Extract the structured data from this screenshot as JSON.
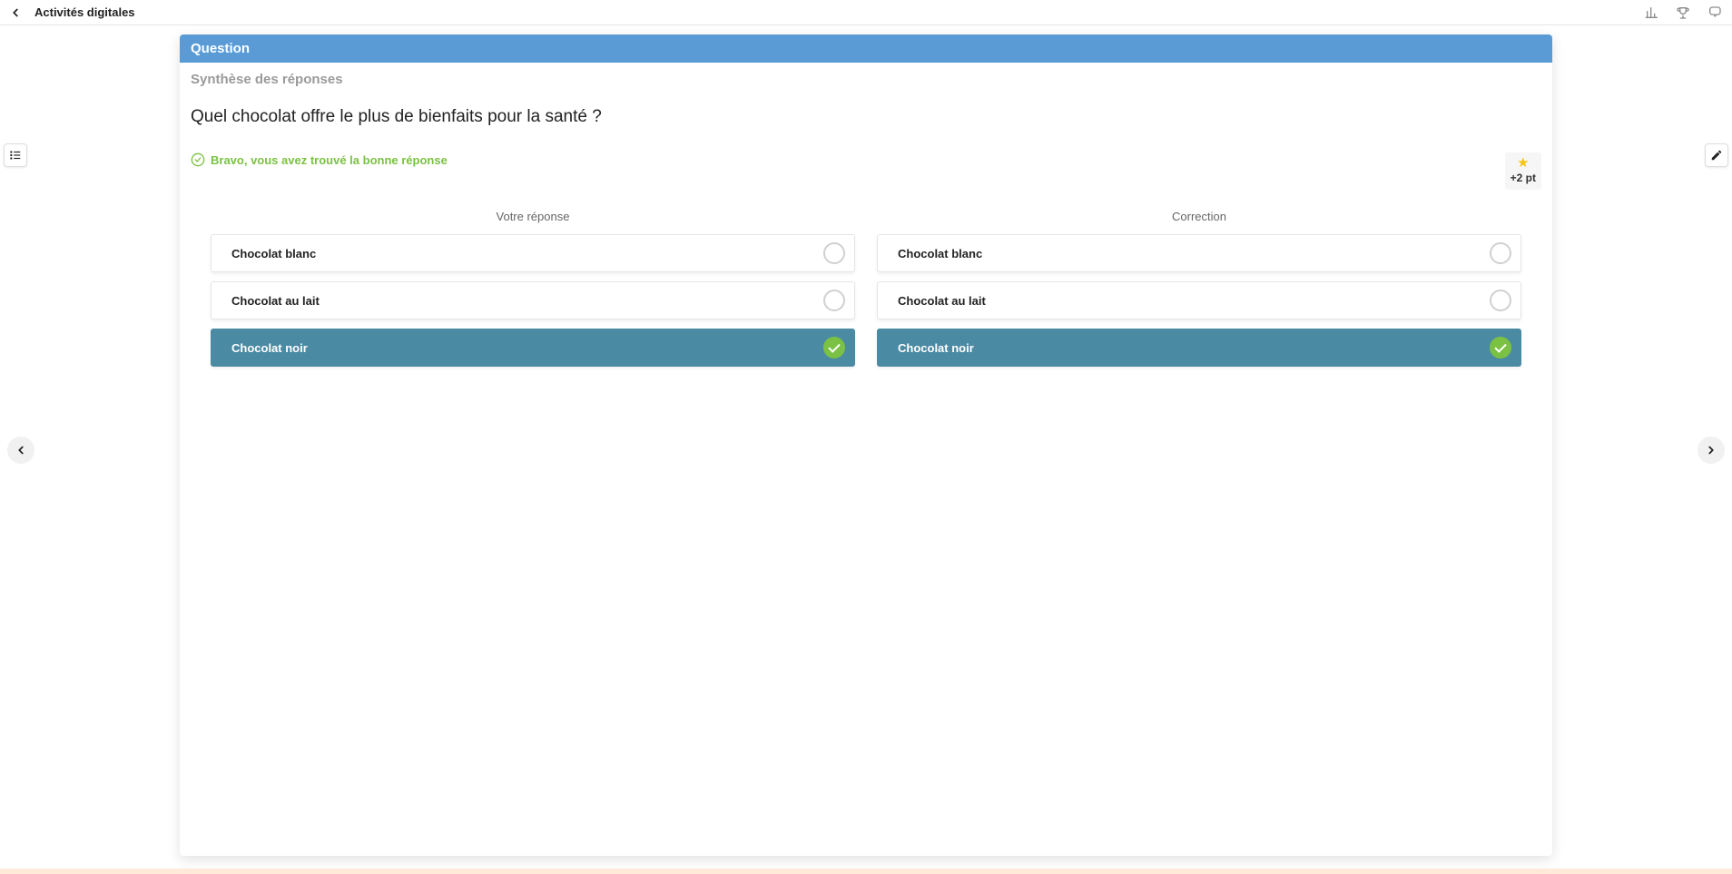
{
  "topbar": {
    "title": "Activités digitales"
  },
  "card": {
    "header": "Question",
    "subheader": "Synthèse des réponses",
    "question_text": "Quel chocolat offre le plus de bienfaits pour la santé ?",
    "feedback_text": "Bravo, vous avez trouvé la bonne réponse",
    "points_text": "+2 pt"
  },
  "columns": {
    "left_title": "Votre réponse",
    "right_title": "Correction"
  },
  "your_answers": [
    {
      "label": "Chocolat blanc",
      "selected": false
    },
    {
      "label": "Chocolat au lait",
      "selected": false
    },
    {
      "label": "Chocolat noir",
      "selected": true
    }
  ],
  "correct_answers": [
    {
      "label": "Chocolat blanc",
      "selected": false
    },
    {
      "label": "Chocolat au lait",
      "selected": false
    },
    {
      "label": "Chocolat noir",
      "selected": true
    }
  ]
}
